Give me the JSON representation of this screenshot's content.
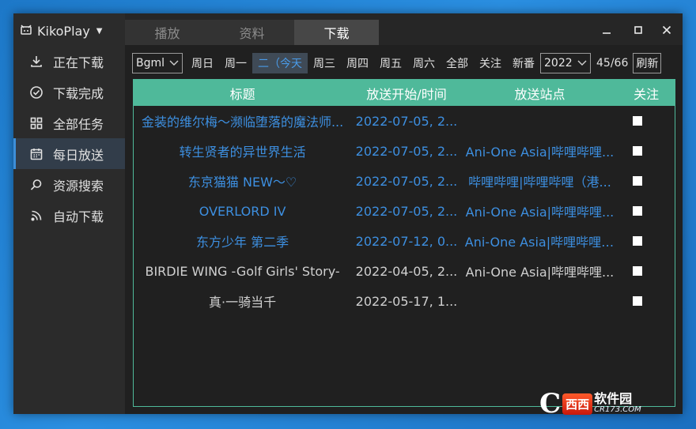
{
  "app": {
    "title": "KikoPlay"
  },
  "sidebar": {
    "items": [
      {
        "label": "正在下载",
        "icon": "download-icon"
      },
      {
        "label": "下载完成",
        "icon": "check-circle-icon"
      },
      {
        "label": "全部任务",
        "icon": "grid-icon"
      },
      {
        "label": "每日放送",
        "icon": "calendar-icon",
        "active": true
      },
      {
        "label": "资源搜索",
        "icon": "search-icon"
      },
      {
        "label": "自动下载",
        "icon": "rss-icon"
      }
    ]
  },
  "tabs": [
    {
      "label": "播放"
    },
    {
      "label": "资料"
    },
    {
      "label": "下载",
      "active": true
    }
  ],
  "toolbar": {
    "source_select": "Bgml",
    "days": [
      "周日",
      "周一",
      "二（今天",
      "周三",
      "周四",
      "周五",
      "周六",
      "全部",
      "关注",
      "新番"
    ],
    "active_day_index": 2,
    "year_select": "2022",
    "count": "45/66",
    "refresh_label": "刷新"
  },
  "table": {
    "headers": [
      "标题",
      "放送开始/时间",
      "放送站点",
      "关注"
    ],
    "rows": [
      {
        "title": "金装的维尔梅～濒临堕落的魔法师...",
        "time": "2022-07-05, 2...",
        "site": "",
        "highlight": true
      },
      {
        "title": "转生贤者的异世界生活",
        "time": "2022-07-05, 2...",
        "site": "Ani-One Asia|哔哩哔哩...",
        "highlight": true
      },
      {
        "title": "东京猫猫 NEW～♡",
        "time": "2022-07-05, 2...",
        "site": "哔哩哔哩|哔哩哔哩（港...",
        "highlight": true
      },
      {
        "title": "OVERLORD IV",
        "time": "2022-07-05, 2...",
        "site": "Ani-One Asia|哔哩哔哩...",
        "highlight": true
      },
      {
        "title": "东方少年 第二季",
        "time": "2022-07-12, 0...",
        "site": "Ani-One Asia|哔哩哔哩|...",
        "highlight": true
      },
      {
        "title": "BIRDIE WING -Golf Girls' Story-",
        "time": "2022-04-05, 2...",
        "site": "Ani-One Asia|哔哩哔哩...",
        "highlight": false
      },
      {
        "title": "真·一骑当千",
        "time": "2022-05-17, 1...",
        "site": "",
        "highlight": false
      }
    ]
  },
  "watermark": {
    "badge": "西西",
    "text": "软件园",
    "url": "CR173.COM"
  },
  "colors": {
    "accent": "#4fb99a",
    "highlight": "#3d8fe0",
    "active_nav": "#3d8fd9"
  }
}
